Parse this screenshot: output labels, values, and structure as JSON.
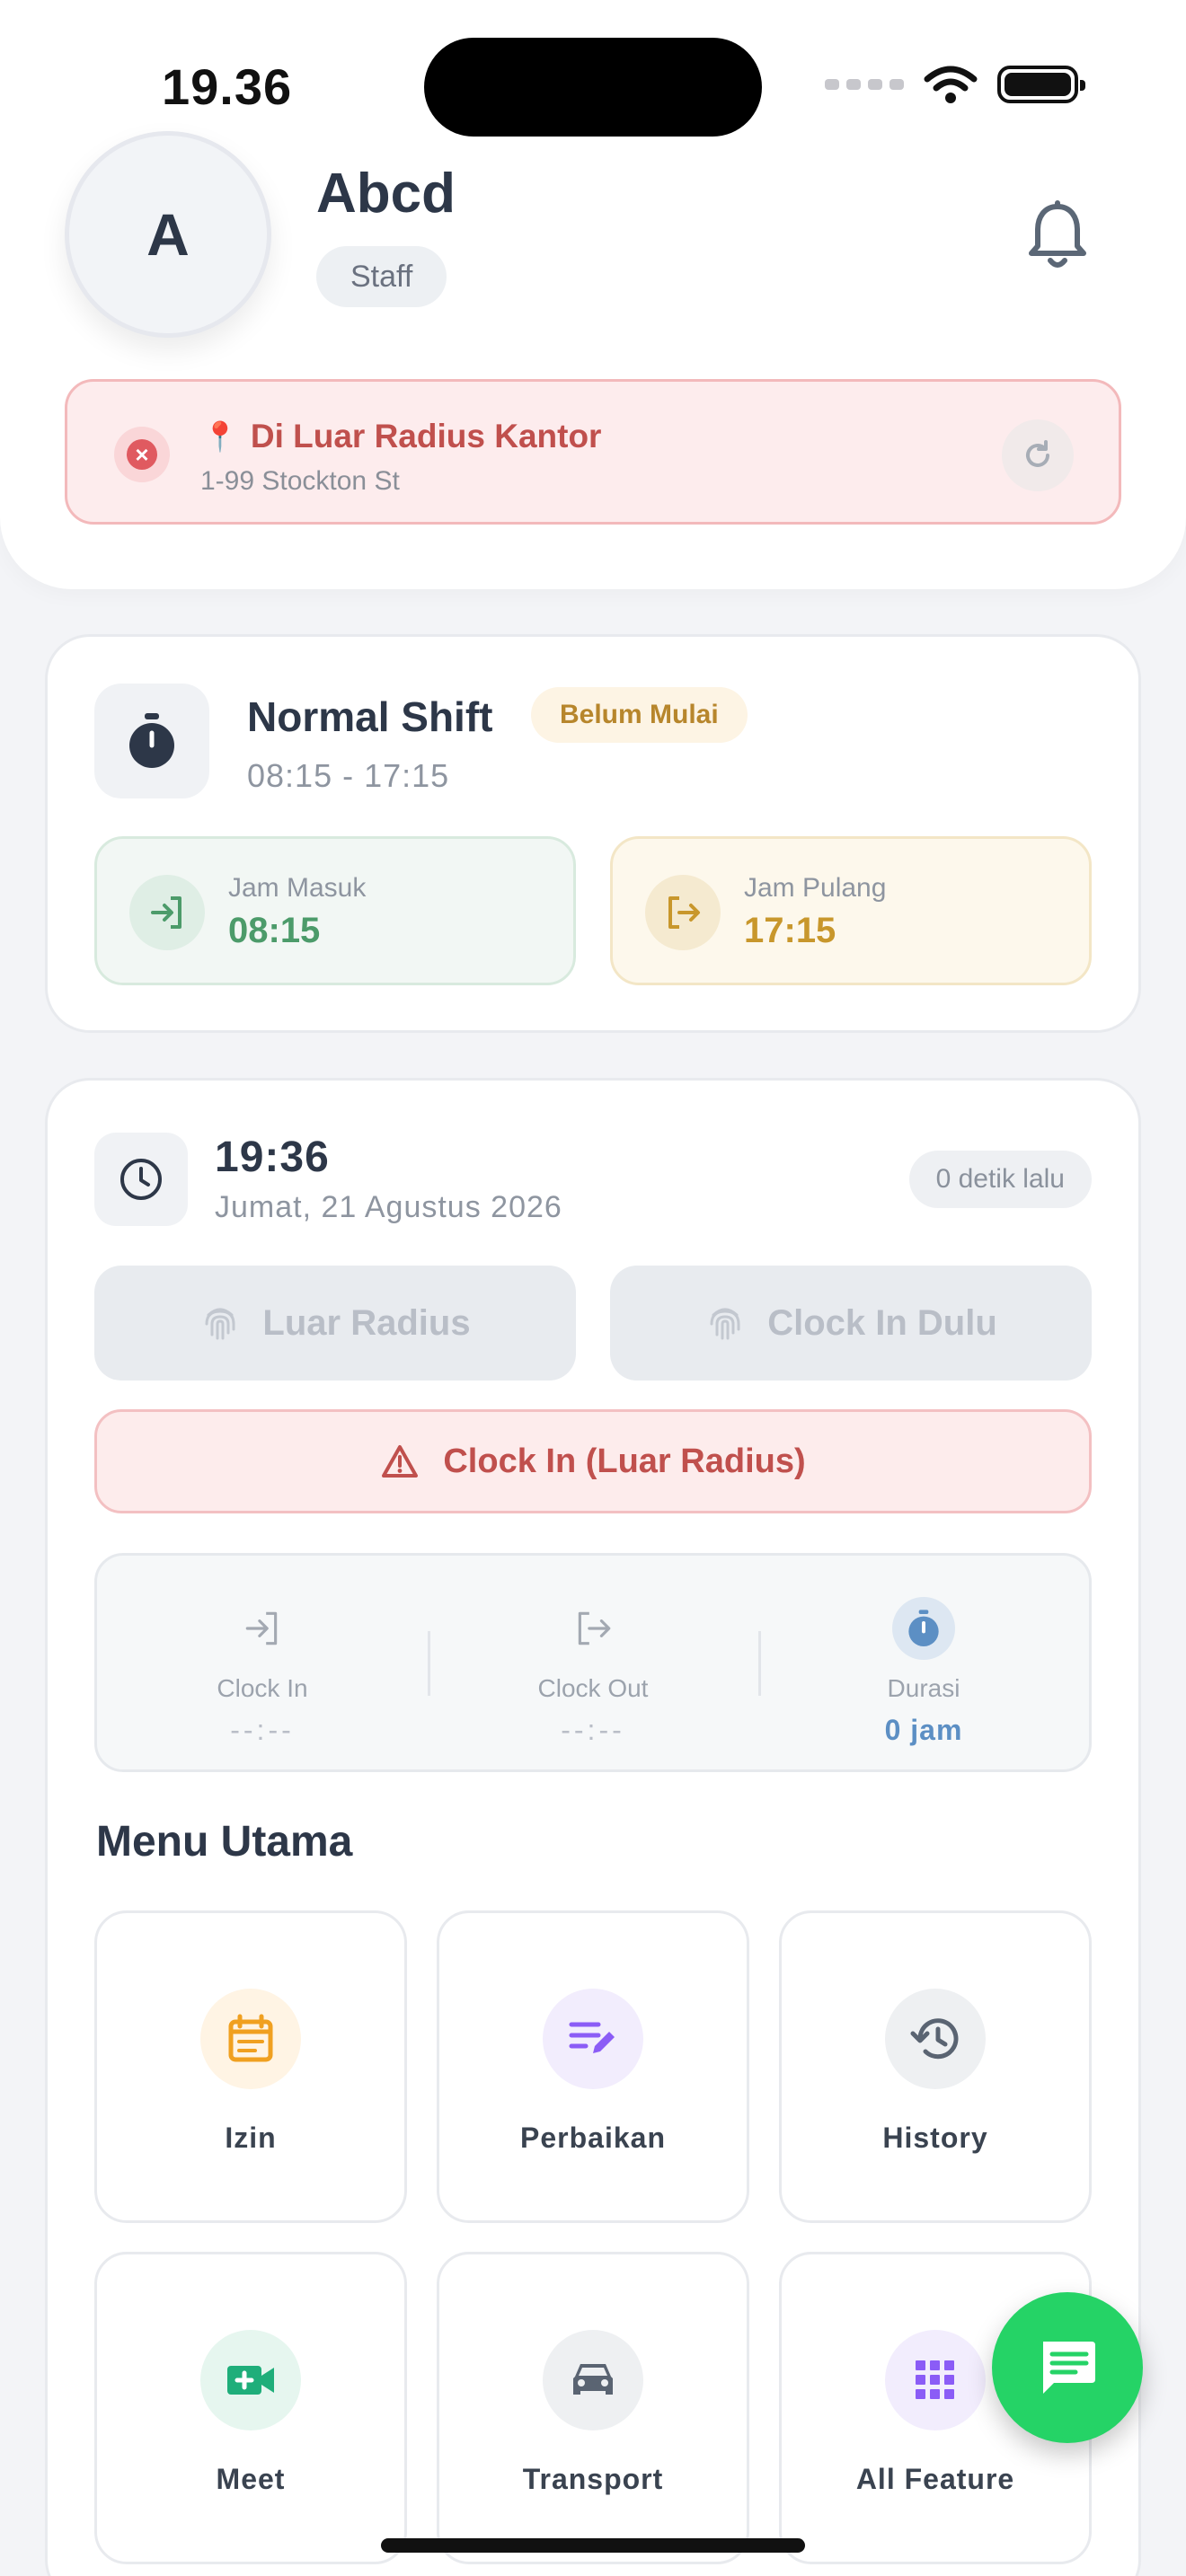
{
  "status_bar": {
    "time": "19.36"
  },
  "profile": {
    "initial": "A",
    "name": "Abcd",
    "role": "Staff"
  },
  "location": {
    "title": "Di Luar Radius Kantor",
    "address": "1-99 Stockton St"
  },
  "shift": {
    "name": "Normal Shift",
    "status": "Belum Mulai",
    "hours": "08:15 - 17:15",
    "in_label": "Jam Masuk",
    "in_time": "08:15",
    "out_label": "Jam Pulang",
    "out_time": "17:15"
  },
  "attendance": {
    "time": "19:36",
    "date": "Jumat, 21 Agustus 2026",
    "updated": "0 detik lalu",
    "btn_left": "Luar Radius",
    "btn_right": "Clock In Dulu",
    "btn_warn": "Clock In (Luar Radius)",
    "summary": {
      "clock_in_label": "Clock In",
      "clock_in_value": "--:--",
      "clock_out_label": "Clock Out",
      "clock_out_value": "--:--",
      "duration_label": "Durasi",
      "duration_value": "0 jam"
    }
  },
  "menu": {
    "title": "Menu Utama",
    "items": [
      {
        "label": "Izin",
        "icon": "calendar-note-icon",
        "color": "#f0a020",
        "bg": "#fff4e4"
      },
      {
        "label": "Perbaikan",
        "icon": "edit-list-icon",
        "color": "#8b5cf6",
        "bg": "#f2edfd"
      },
      {
        "label": "History",
        "icon": "history-icon",
        "color": "#5a6472",
        "bg": "#eef0f2"
      },
      {
        "label": "Meet",
        "icon": "video-add-icon",
        "color": "#1fae7a",
        "bg": "#e6f6ef"
      },
      {
        "label": "Transport",
        "icon": "car-icon",
        "color": "#5a6472",
        "bg": "#eef0f2"
      },
      {
        "label": "All Feature",
        "icon": "grid-icon",
        "color": "#8b5cf6",
        "bg": "#f2edfd"
      }
    ]
  },
  "colors": {
    "accent_green": "#25d366",
    "danger": "#c0504d",
    "success": "#4c9b6a",
    "warning": "#c8972c",
    "duration": "#5c8fc4"
  }
}
